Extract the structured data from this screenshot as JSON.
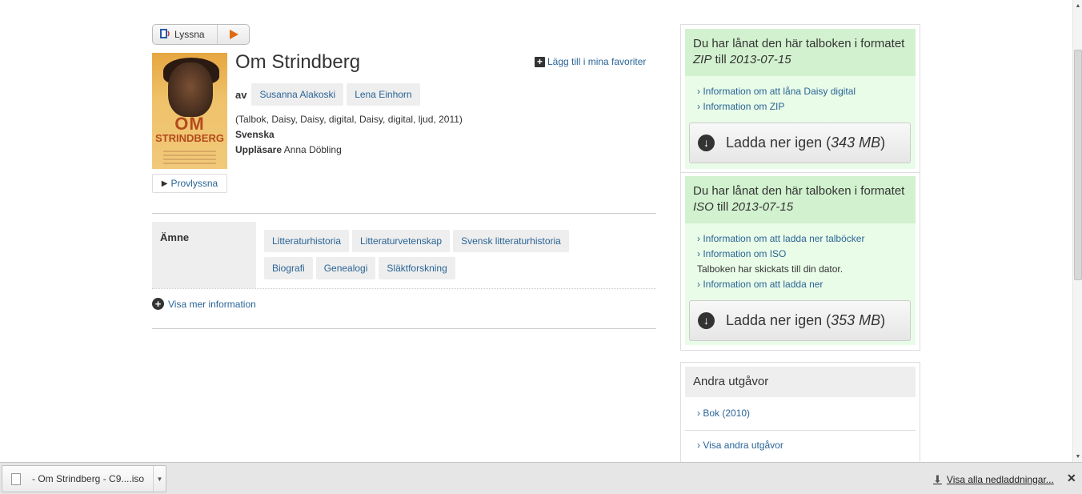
{
  "listen": {
    "label": "Lyssna"
  },
  "book": {
    "title": "Om Strindberg",
    "favorite_label": "Lägg till i mina favoriter",
    "by_label": "av",
    "authors": [
      "Susanna Alakoski",
      "Lena Einhorn"
    ],
    "format_line": "(Talbok, Daisy, Daisy, digital, Daisy, digital, ljud, 2011)",
    "language": "Svenska",
    "reader_label": "Uppläsare",
    "reader_name": "Anna Döbling",
    "preview_label": "Provlyssna",
    "cover": {
      "title_line1": "OM",
      "title_line2": "STRINDBERG"
    }
  },
  "subject": {
    "label": "Ämne",
    "tags": [
      "Litteraturhistoria",
      "Litteraturvetenskap",
      "Svensk litteraturhistoria",
      "Biografi",
      "Genealogi",
      "Släktforskning"
    ]
  },
  "more_info_label": "Visa mer information",
  "loans": [
    {
      "head_prefix": "Du har lånat den här talboken i formatet ",
      "format": "ZIP",
      "head_mid": " till ",
      "date": "2013-07-15",
      "links": [
        "Information om att låna Daisy digital",
        "Information om ZIP"
      ],
      "download_label": "Ladda ner igen (",
      "size": "343 MB",
      "download_suffix": ")"
    },
    {
      "head_prefix": "Du har lånat den här talboken i formatet ",
      "format": "ISO",
      "head_mid": " till ",
      "date": "2013-07-15",
      "links": [
        "Information om att ladda ner talböcker",
        "Information om ISO"
      ],
      "status": "Talboken har skickats till din dator.",
      "extra_link": "Information om att ladda ner",
      "download_label": "Ladda ner igen (",
      "size": "353 MB",
      "download_suffix": ")"
    }
  ],
  "editions": {
    "title": "Andra utgåvor",
    "items": [
      "Bok (2010)",
      "Visa andra utgåvor"
    ]
  },
  "download_bar": {
    "file_name": "- Om Strindberg - C9....iso",
    "show_all": "Visa alla nedladdningar..."
  },
  "colors": {
    "link": "#2a6496",
    "loan_bg": "#e9fce8",
    "loan_head": "#d2f2cf",
    "tag_bg": "#eeeeee"
  }
}
